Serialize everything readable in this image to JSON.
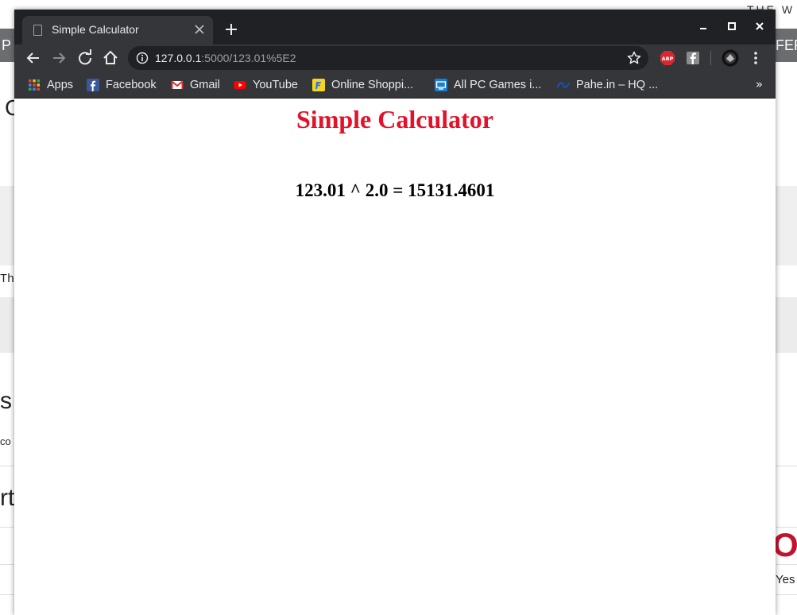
{
  "background_page": {
    "top_right_text": "THE W",
    "left_band_text": "P",
    "right_band_text": "FER",
    "left_heading_fragment": "C",
    "left_mono_fragment": "Thi",
    "left_large_s": "s",
    "left_small_co": "co",
    "left_large_rt": "rt",
    "right_logo_fragment": "O",
    "right_small_yes": "Yes"
  },
  "browser": {
    "tab_title": "Simple Calculator",
    "url_host": "127.0.0.1",
    "url_path": ":5000/123.01%5E2",
    "bookmarks": [
      {
        "label": "Apps",
        "icon": "apps-grid-icon"
      },
      {
        "label": "Facebook",
        "icon": "facebook-icon"
      },
      {
        "label": "Gmail",
        "icon": "gmail-icon"
      },
      {
        "label": "YouTube",
        "icon": "youtube-icon"
      },
      {
        "label": "Online Shoppi...",
        "icon": "flipkart-icon"
      },
      {
        "label": "All PC Games i...",
        "icon": "pc-games-icon"
      },
      {
        "label": "Pahe.in – HQ ...",
        "icon": "pahe-icon"
      }
    ],
    "bookmarks_overflow": "»",
    "extensions": [
      "adblock-plus-icon",
      "facebook-extension-icon",
      "profile-avatar-icon"
    ]
  },
  "page": {
    "heading": "Simple Calculator",
    "result": "123.01 ^ 2.0 = 15131.4601"
  },
  "colors": {
    "heading": "#e3122a",
    "chrome_dark": "#202124",
    "chrome_toolbar": "#35363a"
  }
}
